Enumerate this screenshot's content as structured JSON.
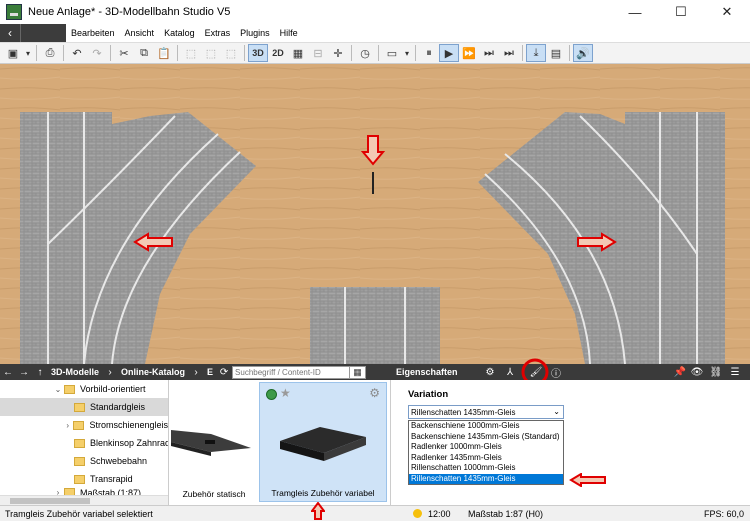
{
  "window": {
    "title": "Neue Anlage* - 3D-Modellbahn Studio V5",
    "minimize": "—",
    "maximize": "☐",
    "close": "✕"
  },
  "menu": {
    "back": "‹",
    "items": [
      "Bearbeiten",
      "Ansicht",
      "Katalog",
      "Extras",
      "Plugins",
      "Hilfe"
    ]
  },
  "toolbar": {
    "mode_3d": "3D",
    "mode_2d": "2D"
  },
  "catalog_panel": {
    "breadcrumb": [
      "3D-Modelle",
      "Online-Katalog",
      "E"
    ],
    "search_placeholder": "Suchbegriff / Content-ID",
    "tree": [
      {
        "label": "Vorbild-orientiert",
        "expanded": true
      },
      {
        "label": "Standardgleis",
        "selected": true
      },
      {
        "label": "Stromschienengleis"
      },
      {
        "label": "Blenkinsop Zahnrad"
      },
      {
        "label": "Schwebebahn"
      },
      {
        "label": "Transrapid"
      },
      {
        "label": "Maßstab (1:87)"
      }
    ],
    "items": [
      {
        "label": "Zubehör statisch"
      },
      {
        "label": "Tramgleis Zubehör variabel",
        "selected": true
      }
    ]
  },
  "properties_panel": {
    "title": "Eigenschaften",
    "variation_label": "Variation",
    "selected_value": "Rillenschatten 1435mm-Gleis",
    "options": [
      "Backenschiene 1000mm-Gleis",
      "Backenschiene 1435mm-Gleis (Standard)",
      "Radlenker 1000mm-Gleis",
      "Radlenker 1435mm-Gleis",
      "Rillenschatten 1000mm-Gleis",
      "Rillenschatten 1435mm-Gleis"
    ]
  },
  "statusbar": {
    "message": "Tramgleis Zubehör variabel selektiert",
    "time": "12:00",
    "scale": "Maßstab 1:87 (H0)",
    "fps": "FPS: 60,0"
  },
  "colors": {
    "ground": "#d4a875",
    "pavement": "#8a8a8a",
    "rail": "#e8e8e8",
    "panel_dark": "#3a3a3a",
    "selection_blue": "#0078d7",
    "annotation_red": "#e00000"
  }
}
